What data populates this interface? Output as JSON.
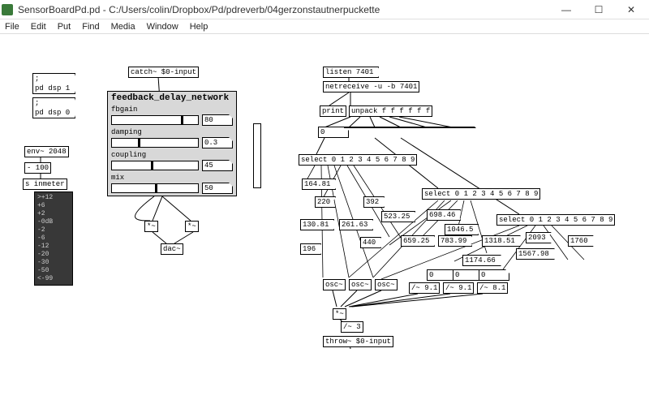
{
  "window": {
    "title": "SensorBoardPd.pd  - C:/Users/colin/Dropbox/Pd/pdreverb/04gerzonstautnerpuckette",
    "min": "—",
    "max": "☐",
    "close": "✕"
  },
  "menu": [
    "File",
    "Edit",
    "Put",
    "Find",
    "Media",
    "Window",
    "Help"
  ],
  "left": {
    "dsp1": ";\npd dsp 1",
    "dsp0": ";\npd dsp 0",
    "env": "env~ 2048",
    "minus100": "- 100",
    "inmeter": "s inmeter",
    "catch": "catch~ $0-input",
    "mult1": "*~",
    "mult2": "*~",
    "dac": "dac~"
  },
  "vu_labels": [
    ">+12",
    "+6",
    "+2",
    "-0dB",
    "-2",
    "-6",
    "-12",
    "-20",
    "-30",
    "-50",
    "<-99"
  ],
  "gop": {
    "title": "feedback_delay_network",
    "rows": [
      {
        "label": "fbgain",
        "value": "80",
        "pos": 0.8
      },
      {
        "label": "damping",
        "value": "0.3",
        "pos": 0.3
      },
      {
        "label": "coupling",
        "value": "45",
        "pos": 0.45
      },
      {
        "label": "mix",
        "value": "50",
        "pos": 0.5
      }
    ]
  },
  "net": {
    "listen": "listen 7401",
    "netreceive": "netreceive -u -b 7401",
    "print": "print",
    "unpack": "unpack f f f f f f"
  },
  "sel0_items": [
    "0",
    "",
    "",
    "",
    "",
    ""
  ],
  "sel_obj": "select 0 1 2 3 4 5 6 7 8 9",
  "freqs_a": [
    "164.81",
    "220",
    "130.81",
    "196"
  ],
  "freqs_b": [
    "392",
    "523.25",
    "261.63",
    "440"
  ],
  "freqs_c": [
    "698.46",
    "1046.5",
    "659.25",
    "783.99"
  ],
  "freqs_d": [
    "2093",
    "1318.51",
    "1174.66",
    "1760",
    "1567.98"
  ],
  "osc": "osc~",
  "div91": "/~ 9.1",
  "div81": "/~ 8.1",
  "bottom": {
    "mult": "*~",
    "div3": "/~ 3",
    "throw": "throw~ $0-input",
    "zeros": "0"
  }
}
